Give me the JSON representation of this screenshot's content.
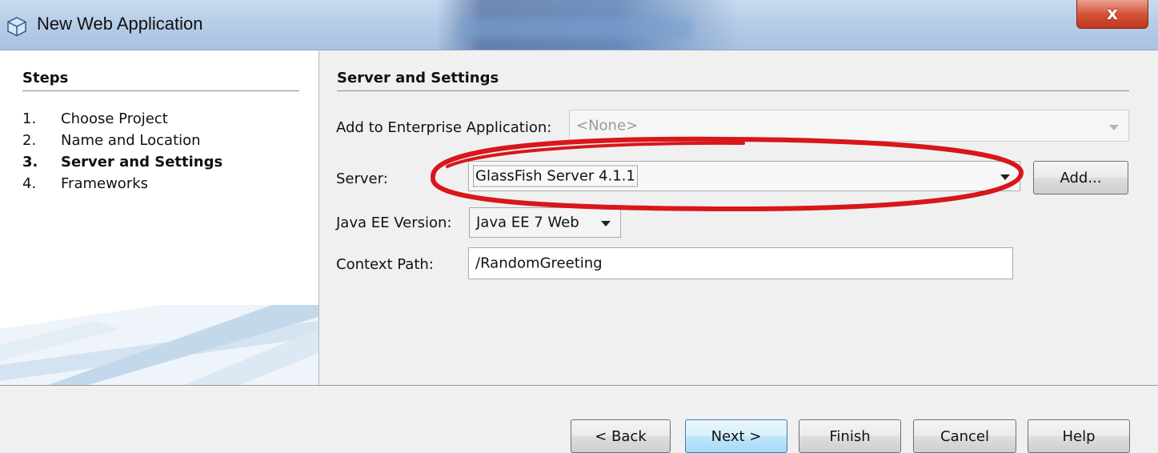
{
  "window": {
    "title": "New Web Application",
    "close_label": "x"
  },
  "steps": {
    "title": "Steps",
    "items": [
      {
        "num": "1.",
        "label": "Choose Project",
        "current": false
      },
      {
        "num": "2.",
        "label": "Name and Location",
        "current": false
      },
      {
        "num": "3.",
        "label": "Server and Settings",
        "current": true
      },
      {
        "num": "4.",
        "label": "Frameworks",
        "current": false
      }
    ]
  },
  "main": {
    "section_title": "Server and Settings",
    "enterprise": {
      "label": "Add to Enterprise Application:",
      "value": "<None>",
      "enabled": false
    },
    "server": {
      "label": "Server:",
      "value": "GlassFish Server 4.1.1",
      "add_label": "Add..."
    },
    "javaee": {
      "label": "Java EE Version:",
      "value": "Java EE 7 Web"
    },
    "context": {
      "label": "Context Path:",
      "value": "/RandomGreeting"
    }
  },
  "footer": {
    "back_label": "< Back",
    "next_label": "Next >",
    "finish_label": "Finish",
    "cancel_label": "Cancel",
    "help_label": "Help"
  },
  "colors": {
    "annotation": "#d8161b",
    "title_bar": "#b7cde8",
    "close_button": "#c1361c",
    "default_button_border": "#3c7fb1"
  },
  "icons": {
    "app": "netbeans-cube-icon",
    "close": "close-icon",
    "dropdown": "chevron-down-icon"
  }
}
